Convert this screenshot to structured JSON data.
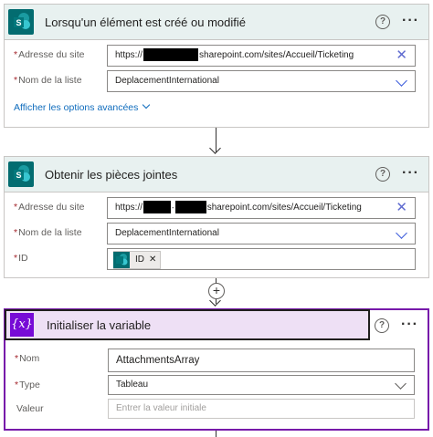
{
  "card1": {
    "title": "Lorsqu'un élément est créé ou modifié",
    "site_label": "Adresse du site",
    "site_value_prefix": "https://",
    "site_value_suffix": "sharepoint.com/sites/Accueil/Ticketing",
    "list_label": "Nom de la liste",
    "list_value": "DeplacementInternational",
    "advanced": "Afficher les options avancées"
  },
  "card2": {
    "title": "Obtenir les pièces jointes",
    "site_label": "Adresse du site",
    "site_value_prefix": "https://",
    "site_value_mid": "-",
    "site_value_suffix": "sharepoint.com/sites/Accueil/Ticketing",
    "list_label": "Nom de la liste",
    "list_value": "DeplacementInternational",
    "id_label": "ID",
    "id_token": "ID"
  },
  "card3": {
    "title": "Initialiser la variable",
    "name_label": "Nom",
    "name_value": "AttachmentsArray",
    "type_label": "Type",
    "type_value": "Tableau",
    "value_label": "Valeur",
    "value_placeholder": "Entrer la valeur initiale"
  },
  "common": {
    "required_mark": "*",
    "help_glyph": "?",
    "more_glyph": "···",
    "close_glyph": "✕",
    "plus_glyph": "+",
    "var_glyph": "{x}"
  },
  "colors": {
    "sharepoint": "#036c70",
    "variable": "#770bd6",
    "accent_border": "#7719aa",
    "link": "#0f6cbd"
  }
}
